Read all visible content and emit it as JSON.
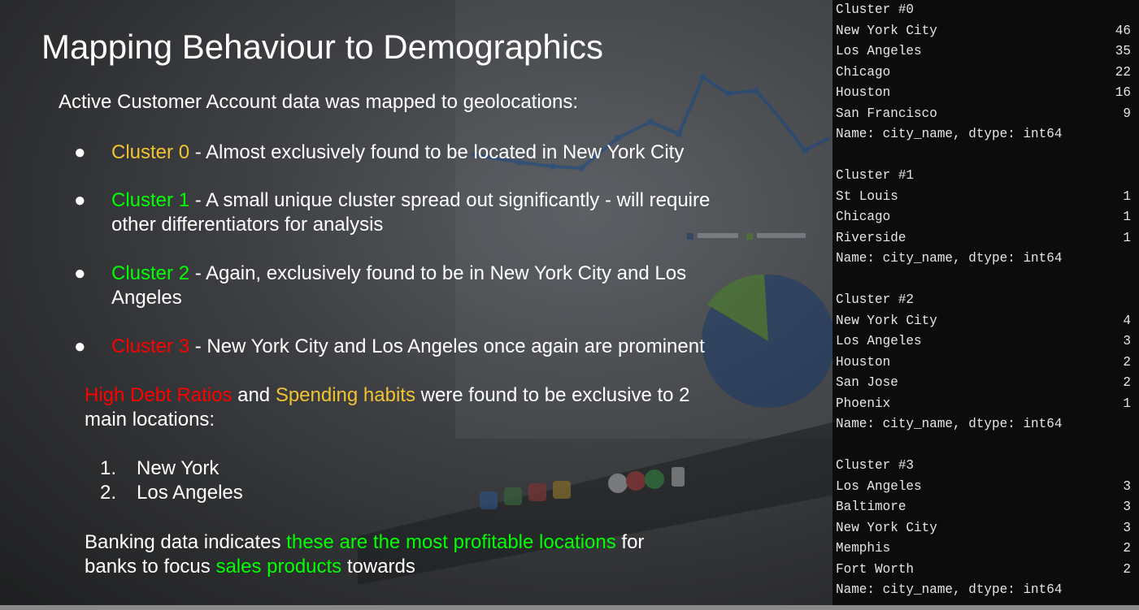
{
  "slide": {
    "title": "Mapping Behaviour to Demographics",
    "intro": "Active Customer Account data was mapped to geolocations:",
    "bullet_symbol": "●",
    "bullets": [
      {
        "label": "Cluster 0",
        "color": "#f1c232",
        "line1": " - Almost exclusively found to be located in New York City",
        "line2": ""
      },
      {
        "label": "Cluster 1",
        "color": "#00ff00",
        "line1": " - A small unique cluster spread out significantly - will require",
        "line2": "other differentiators for analysis"
      },
      {
        "label": "Cluster 2",
        "color": "#00ff00",
        "line1": " - Again, exclusively found to be in New York City and Los",
        "line2": "Angeles"
      },
      {
        "label": "Cluster 3",
        "color": "#ff0000",
        "line1": " - New York City and Los Angeles once again are prominent",
        "line2": ""
      }
    ],
    "summary": {
      "part1": "High Debt Ratios",
      "part2": " and ",
      "part3": "Spending habits",
      "part4": " were found to be exclusive to 2",
      "line2": "main locations:"
    },
    "locations": [
      {
        "num": "1.",
        "name": "New York"
      },
      {
        "num": "2.",
        "name": "Los Angeles"
      }
    ],
    "conclusion": {
      "part1": "Banking data indicates ",
      "part2": "these are the most profitable locations",
      "part3": " for",
      "line2_part1": "banks to focus ",
      "line2_part2": "sales products",
      "line2_part3": " towards"
    }
  },
  "console": {
    "footer": "Name: city_name, dtype: int64",
    "clusters": [
      {
        "header": "Cluster #0",
        "rows": [
          {
            "city": "New York City",
            "count": "46"
          },
          {
            "city": "Los Angeles",
            "count": "35"
          },
          {
            "city": "Chicago",
            "count": "22"
          },
          {
            "city": "Houston",
            "count": "16"
          },
          {
            "city": "San Francisco",
            "count": "9"
          }
        ]
      },
      {
        "header": "Cluster #1",
        "rows": [
          {
            "city": "St Louis",
            "count": "1"
          },
          {
            "city": "Chicago",
            "count": "1"
          },
          {
            "city": "Riverside",
            "count": "1"
          }
        ]
      },
      {
        "header": "Cluster #2",
        "rows": [
          {
            "city": "New York City",
            "count": "4"
          },
          {
            "city": "Los Angeles",
            "count": "3"
          },
          {
            "city": "Houston",
            "count": "2"
          },
          {
            "city": "San Jose",
            "count": "2"
          },
          {
            "city": "Phoenix",
            "count": "1"
          }
        ]
      },
      {
        "header": "Cluster #3",
        "rows": [
          {
            "city": "Los Angeles",
            "count": "3"
          },
          {
            "city": "Baltimore",
            "count": "3"
          },
          {
            "city": "New York City",
            "count": "3"
          },
          {
            "city": "Memphis",
            "count": "2"
          },
          {
            "city": "Fort Worth",
            "count": "2"
          }
        ]
      }
    ]
  }
}
